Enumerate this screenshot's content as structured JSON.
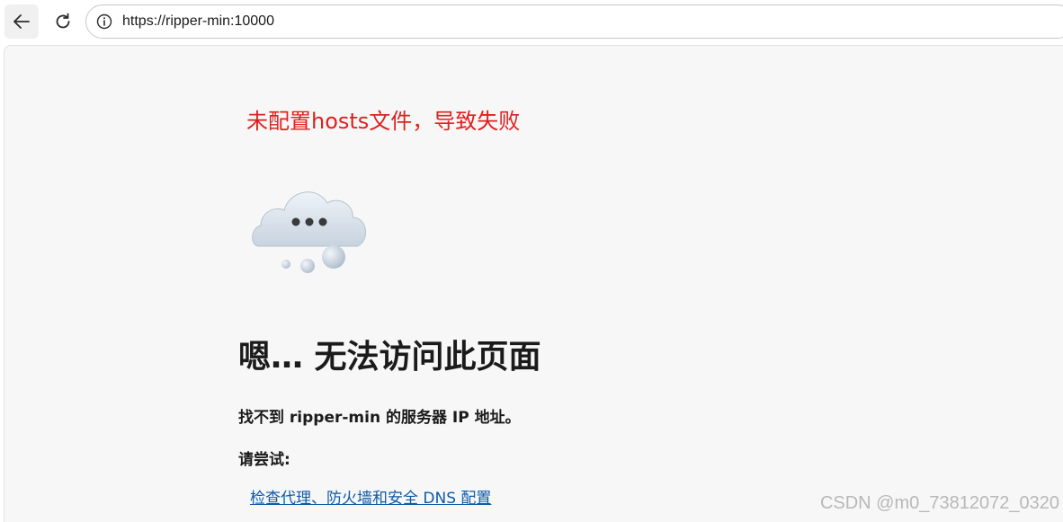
{
  "browser": {
    "url": "https://ripper-min:10000",
    "back_icon": "arrow-left-icon",
    "refresh_icon": "refresh-icon",
    "site_info_icon": "info-circle-icon"
  },
  "page": {
    "annotation": "未配置hosts文件，导致失败",
    "annotation_color": "#e02020",
    "illustration": "cloud-icon",
    "heading": "嗯… 无法访问此页面",
    "subtext": "找不到 ripper-min 的服务器 IP 地址。",
    "try_label": "请尝试:",
    "suggestions": [
      "检查代理、防火墙和安全 DNS 配置"
    ],
    "link_color": "#0f5aa8"
  },
  "watermark": "CSDN @m0_73812072_0320"
}
